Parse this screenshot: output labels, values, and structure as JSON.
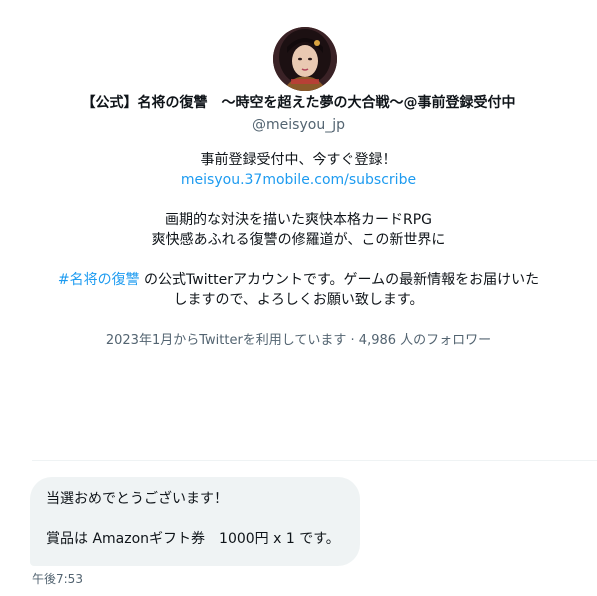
{
  "profile": {
    "name": "【公式】名将の復讐　～時空を超えた夢の大合戦～@事前登録受付中",
    "handle": "@meisyou_jp",
    "avatar": "game-character-avatar"
  },
  "bio": {
    "line1": "事前登録受付中、今すぐ登録！",
    "link": "meisyou.37mobile.com/subscribe",
    "line3": "画期的な対決を描いた爽快本格カードRPG",
    "line4": "爽快感あふれる復讐の修羅道が、この新世界に",
    "hashtag": "#名将の復讐",
    "line5_rest": " の公式Twitterアカウントです。ゲームの最新情報をお届けいた",
    "line6": "しますので、よろしくお願い致します。"
  },
  "meta": {
    "joined_and_followers": "2023年1月からTwitterを利用しています · 4,986 人のフォロワー"
  },
  "message": {
    "line1": "当選おめでとうございます！",
    "line2": "賞品は Amazonギフト券　1000円 x 1 です。",
    "timestamp": "午後7:53"
  },
  "colors": {
    "link": "#1d9bf0",
    "secondary_text": "#536471",
    "bubble_bg": "#eff3f4"
  }
}
